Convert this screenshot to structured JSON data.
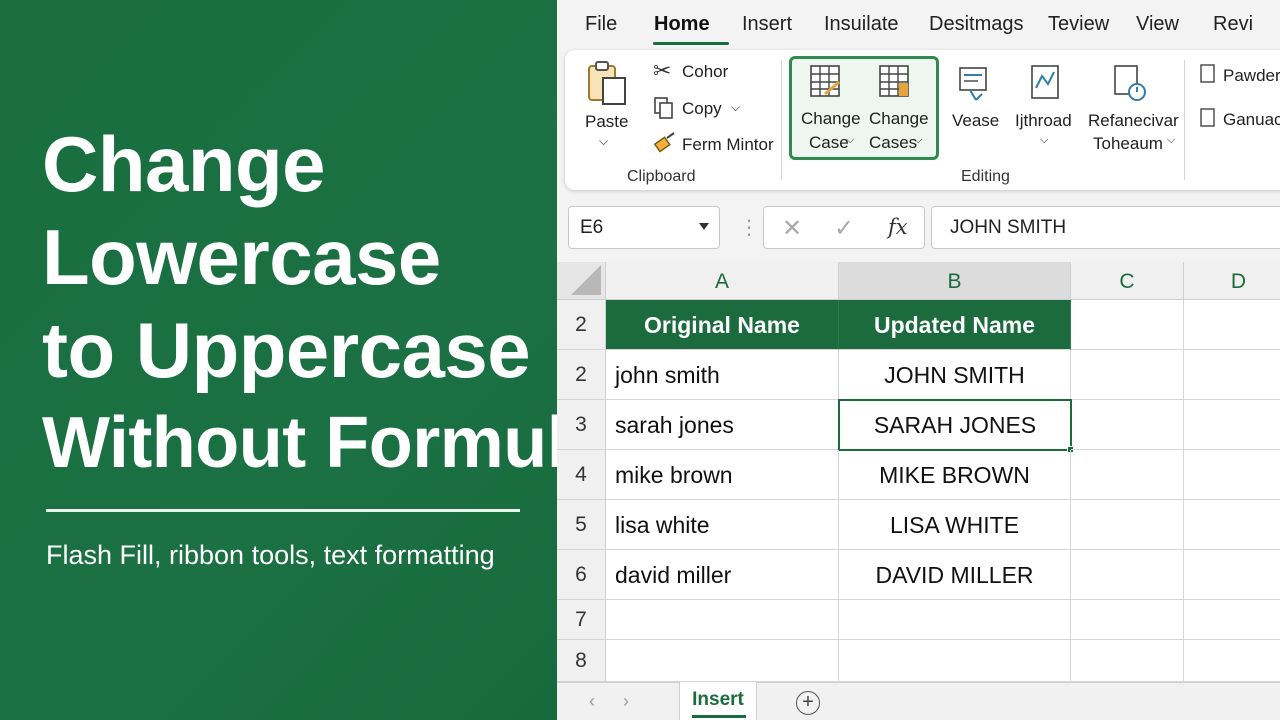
{
  "headline": {
    "line1": "Change",
    "line2": "Lowercase",
    "line3": "to Uppercase",
    "line4": "Without Formula"
  },
  "subtitle": "Flash Fill, ribbon tools, text formatting",
  "tabs": [
    "File",
    "Home",
    "Insert",
    "Insuilate",
    "Desitmags",
    "Teview",
    "View",
    "Revi"
  ],
  "active_tab": "Home",
  "ribbon": {
    "paste_label": "Paste",
    "cut_label": "Cohor",
    "copy_label": "Copy",
    "format_painter_label": "Ferm Mintor",
    "clipboard_group": "Clipboard",
    "change_case_1": "Change",
    "change_case_2": "Case",
    "change_cases_1": "Change",
    "change_cases_2": "Cases",
    "vease_label": "Vease",
    "ijthroad_label": "Ijthroad",
    "refanecivar_1": "Refanecivar",
    "refanecivar_2": "Toheaum",
    "editing_group": "Editing",
    "powder_label": "Pawder",
    "ganuact_label": "Ganuact"
  },
  "formula_bar": {
    "name_box": "E6",
    "fx_label": "fx",
    "value": "JOHN SMITH"
  },
  "grid": {
    "columns": [
      "A",
      "B",
      "C",
      "D"
    ],
    "selected_column": "B",
    "row_numbers": [
      "2",
      "2",
      "3",
      "4",
      "5",
      "6",
      "7",
      "8"
    ],
    "header": {
      "a": "Original Name",
      "b": "Updated Name"
    },
    "rows": [
      {
        "a": "john smith",
        "b": "JOHN SMITH"
      },
      {
        "a": "sarah jones",
        "b": "SARAH JONES"
      },
      {
        "a": "mike brown",
        "b": "MIKE BROWN"
      },
      {
        "a": "lisa white",
        "b": "LISA WHITE"
      },
      {
        "a": "david miller",
        "b": "DAVID MILLER"
      }
    ]
  },
  "sheet_tab": "Insert",
  "colors": {
    "brand_green": "#1c6b3e",
    "panel_green": "#1a6e3f"
  }
}
